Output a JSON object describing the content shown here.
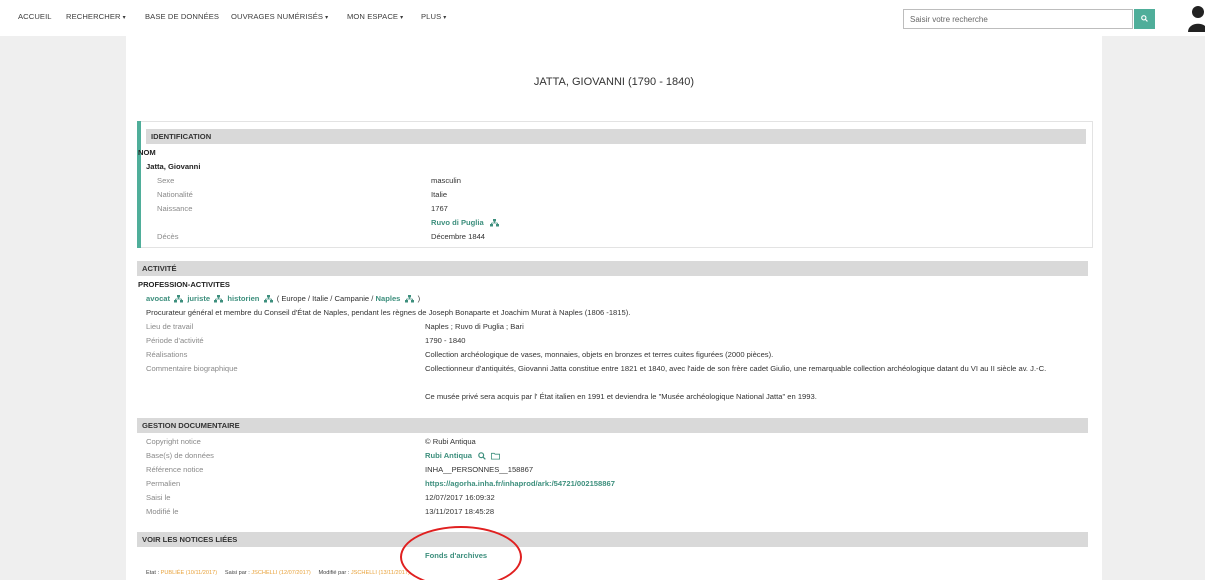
{
  "nav": {
    "items": [
      {
        "label": "ACCUEIL",
        "caret": ""
      },
      {
        "label": "RECHERCHER",
        "caret": "▾"
      },
      {
        "label": "BASE DE DONNÉES",
        "caret": ""
      },
      {
        "label": "OUVRAGES NUMÉRISÉS",
        "caret": "▾"
      },
      {
        "label": "MON ESPACE",
        "caret": "▾"
      },
      {
        "label": "PLUS",
        "caret": "▾"
      }
    ],
    "search_placeholder": "Saisir votre recherche"
  },
  "title": "JATTA, GIOVANNI (1790 - 1840)",
  "identification": {
    "header": "IDENTIFICATION",
    "nom_label": "NOM",
    "name": "Jatta, Giovanni",
    "rows": [
      {
        "label": "Sexe",
        "value": "masculin"
      },
      {
        "label": "Nationalité",
        "value": "Italie"
      },
      {
        "label": "Naissance",
        "value": "1767"
      },
      {
        "label": "Décès",
        "value": "Décembre 1844"
      }
    ],
    "birth_place_link": "Ruvo di Puglia"
  },
  "activite": {
    "header": "ACTIVITÉ",
    "profession_label": "PROFESSION-ACTIVITES",
    "professions": [
      "avocat",
      "juriste",
      "historien"
    ],
    "location_prefix": "( Europe / Italie / Campanie /",
    "location_link": "Naples",
    "location_suffix": ")",
    "description": "Procurateur général et membre du Conseil d'État de Naples, pendant les règnes de Joseph Bonaparte et Joachim Murat à Naples (1806 -1815).",
    "rows": [
      {
        "label": "Lieu de travail",
        "value": "Naples ; Ruvo di Puglia ; Bari"
      },
      {
        "label": "Période d'activité",
        "value": "1790 - 1840"
      },
      {
        "label": "Réalisations",
        "value": "Collection archéologique de vases, monnaies, objets en bronzes et terres cuites figurées (2000 pièces)."
      }
    ],
    "commentaire_label": "Commentaire biographique",
    "commentaire_1": "Collectionneur d'antiquités, Giovanni Jatta constitue entre 1821 et 1840, avec l'aide de son frère cadet Giulio, une remarquable collection archéologique datant du VI au II siècle av. J.-C.",
    "commentaire_2": "Ce musée privé sera acquis par l' État italien en 1991 et deviendra le \"Musée archéologique National Jatta\" en 1993."
  },
  "gestion": {
    "header": "GESTION DOCUMENTAIRE",
    "copyright_label": "Copyright notice",
    "copyright_value": "© Rubi Antiqua",
    "bases_label": "Base(s) de données",
    "bases_value": "Rubi Antiqua",
    "reference_label": "Référence notice",
    "reference_value": "INHA__PERSONNES__158867",
    "permalien_label": "Permalien",
    "permalien_value": "https://agorha.inha.fr/inhaprod/ark:/54721/002158867",
    "saisi_label": "Saisi le",
    "saisi_value": "12/07/2017 16:09:32",
    "modifie_label": "Modifié le",
    "modifie_value": "13/11/2017 18:45:28"
  },
  "liees": {
    "header": "VOIR LES NOTICES LIÉES",
    "link": "Fonds d'archives"
  },
  "footer": {
    "etat_label": "Etat :",
    "etat_value": "PUBLIÉE (10/11/2017)",
    "saisi_label": "Saisi par :",
    "saisi_value": "JSCHELLI (12/07/2017)",
    "modifie_label": "Modifié par :",
    "modifie_value": "JSCHELLI (13/11/2017)"
  },
  "colors": {
    "accent": "#4fae9a",
    "link": "#3d8f7d",
    "annotation": "#e02020",
    "status": "#e8a23a"
  },
  "icons": [
    "search-icon",
    "user-icon",
    "tree-icon",
    "folder-icon"
  ]
}
